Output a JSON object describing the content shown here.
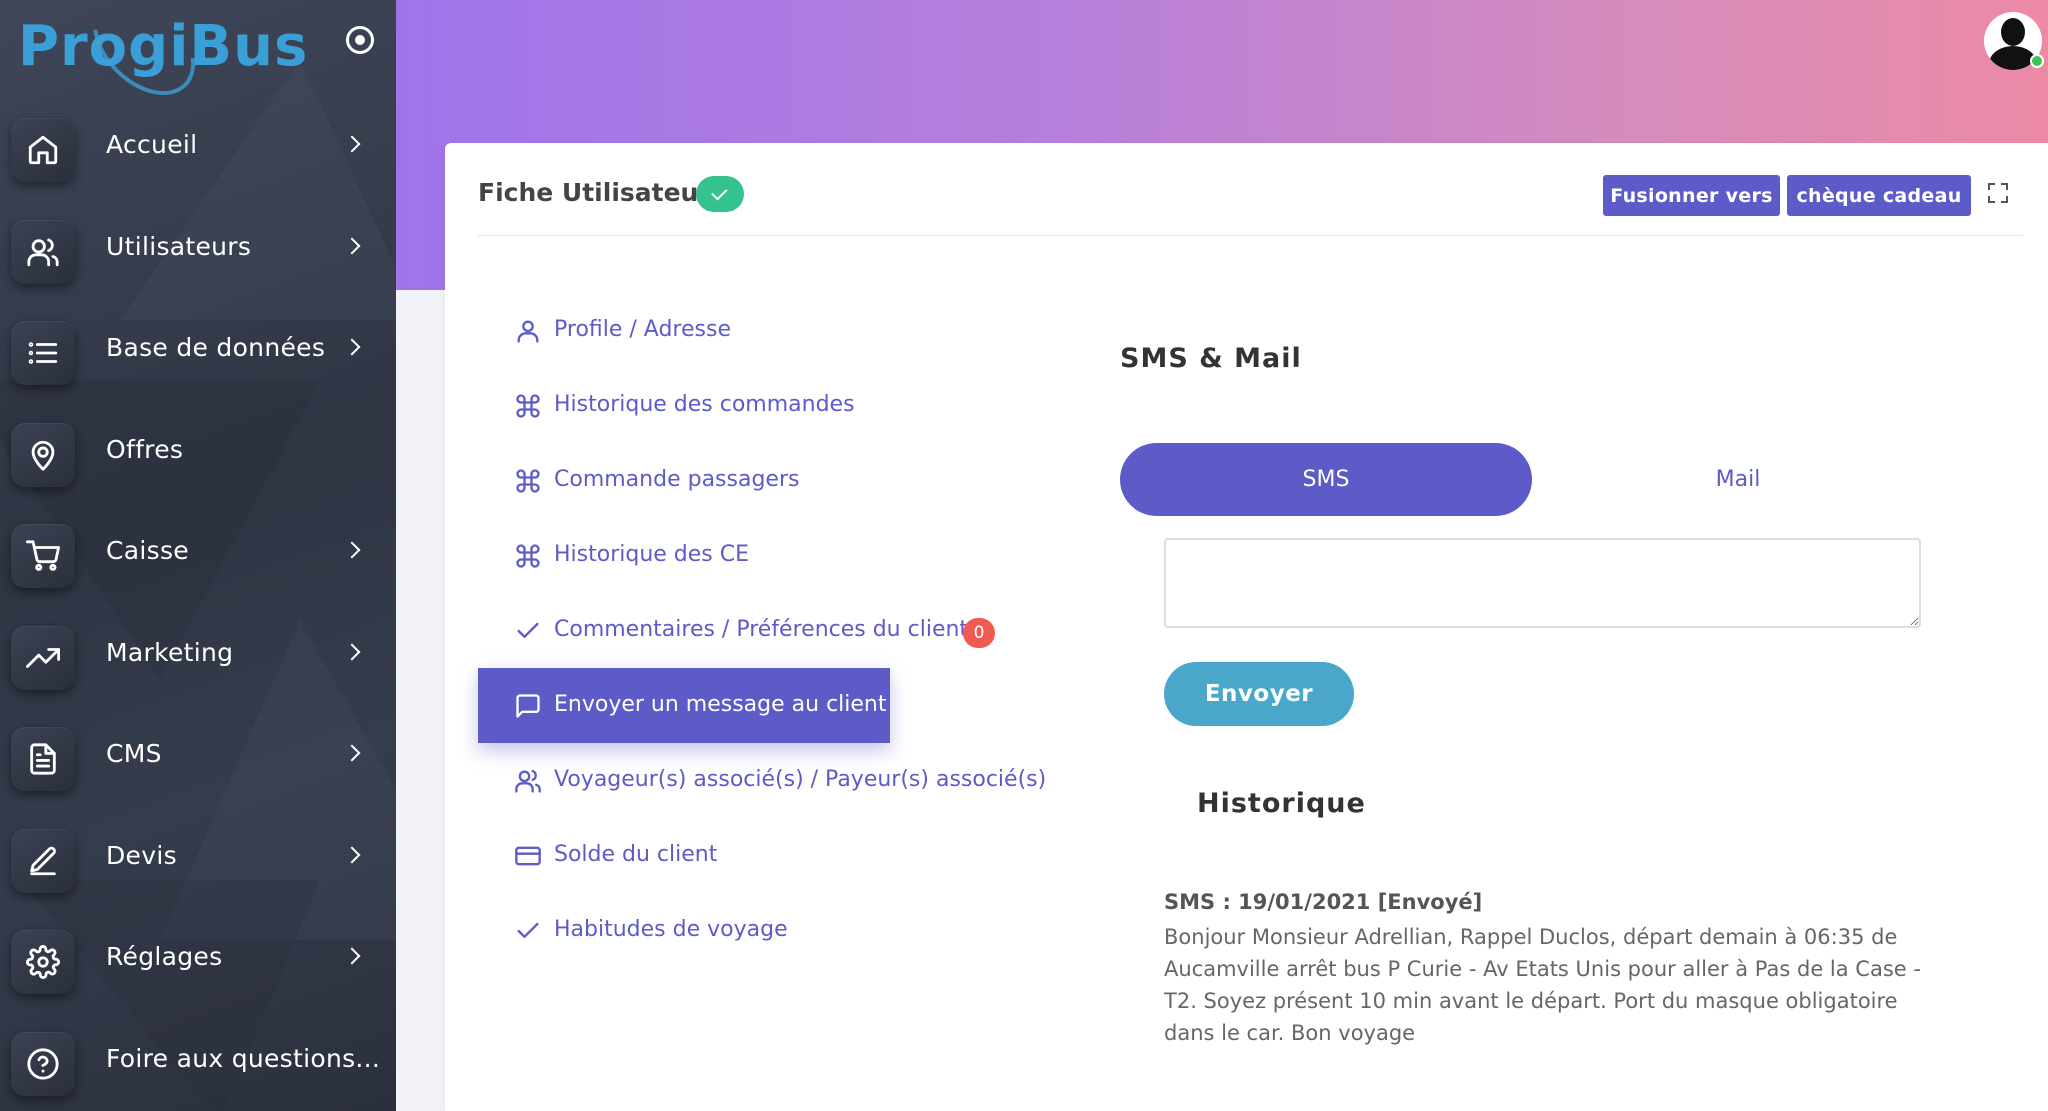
{
  "brand": {
    "logo_text": "ProgiBus"
  },
  "sidebar": {
    "items": [
      {
        "label": "Accueil",
        "icon": "home-icon",
        "has_submenu": true
      },
      {
        "label": "Utilisateurs",
        "icon": "users-icon",
        "has_submenu": true
      },
      {
        "label": "Base de données",
        "icon": "list-icon",
        "has_submenu": true
      },
      {
        "label": "Offres",
        "icon": "map-pin-icon",
        "has_submenu": false
      },
      {
        "label": "Caisse",
        "icon": "cart-icon",
        "has_submenu": true
      },
      {
        "label": "Marketing",
        "icon": "trending-up-icon",
        "has_submenu": true
      },
      {
        "label": "CMS",
        "icon": "document-icon",
        "has_submenu": true
      },
      {
        "label": "Devis",
        "icon": "edit-icon",
        "has_submenu": true
      },
      {
        "label": "Réglages",
        "icon": "gear-icon",
        "has_submenu": true
      },
      {
        "label": "Foire aux questions...",
        "icon": "help-circle-icon",
        "has_submenu": false
      }
    ]
  },
  "card": {
    "title": "Fiche Utilisateur",
    "buttons": {
      "merge": "Fusionner vers",
      "gift": "chèque cadeau"
    }
  },
  "subnav": {
    "items": [
      {
        "label": "Profile / Adresse",
        "icon": "user-icon"
      },
      {
        "label": "Historique des commandes",
        "icon": "command-icon"
      },
      {
        "label": "Commande passagers",
        "icon": "command-icon"
      },
      {
        "label": "Historique des CE",
        "icon": "command-icon"
      },
      {
        "label": "Commentaires / Préférences du client",
        "icon": "check-icon",
        "badge": "0"
      },
      {
        "label": "Envoyer un message au client",
        "icon": "message-icon",
        "active": true
      },
      {
        "label": "Voyageur(s) associé(s) / Payeur(s) associé(s)",
        "icon": "users-icon"
      },
      {
        "label": "Solde du client",
        "icon": "credit-card-icon"
      },
      {
        "label": "Habitudes de voyage",
        "icon": "check-icon"
      }
    ]
  },
  "panel": {
    "title": "SMS & Mail",
    "tabs": {
      "sms": "SMS",
      "mail": "Mail"
    },
    "message_value": "",
    "send_label": "Envoyer",
    "history_title": "Historique",
    "history": [
      {
        "header": "SMS : 19/01/2021 [Envoyé]",
        "body": "Bonjour Monsieur Adrellian, Rappel Duclos, départ demain à 06:35 de Aucamville arrêt bus P Curie - Av Etats Unis pour aller à Pas de la Case - T2. Soyez présent 10 min avant le départ. Port du masque obligatoire dans le car. Bon voyage"
      }
    ]
  },
  "colors": {
    "accent": "#5d5bc7",
    "send": "#4aa7c9",
    "success": "#34c38f",
    "danger": "#f05a50"
  }
}
